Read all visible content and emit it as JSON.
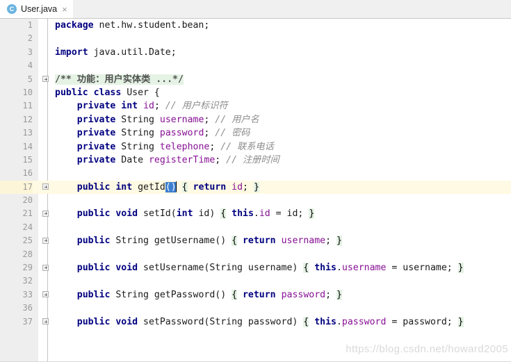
{
  "tab": {
    "icon": "java-class-icon",
    "icon_letter": "C",
    "title": "User.java",
    "close_glyph": "×",
    "accent_color": "#4a86c8"
  },
  "editor": {
    "lines": [
      {
        "num": "1",
        "fold": false,
        "caret": false,
        "tokens": [
          {
            "t": "package",
            "c": "kw"
          },
          {
            "t": " net.hw.student.bean;",
            "c": "txt"
          }
        ]
      },
      {
        "num": "2",
        "fold": false,
        "caret": false,
        "tokens": []
      },
      {
        "num": "3",
        "fold": false,
        "caret": false,
        "tokens": [
          {
            "t": "import",
            "c": "kw"
          },
          {
            "t": " java.util.Date;",
            "c": "txt"
          }
        ]
      },
      {
        "num": "4",
        "fold": false,
        "caret": false,
        "tokens": []
      },
      {
        "num": "5",
        "fold": true,
        "caret": false,
        "tokens": [
          {
            "t": "/** 功能：用户实体类 ...*/",
            "c": "doc-fold"
          }
        ]
      },
      {
        "num": "10",
        "fold": false,
        "caret": false,
        "tokens": [
          {
            "t": "public class",
            "c": "kw"
          },
          {
            "t": " User {",
            "c": "txt"
          }
        ]
      },
      {
        "num": "11",
        "fold": false,
        "caret": false,
        "tokens": [
          {
            "t": "    ",
            "c": "txt"
          },
          {
            "t": "private int",
            "c": "kw"
          },
          {
            "t": " ",
            "c": "txt"
          },
          {
            "t": "id",
            "c": "fld"
          },
          {
            "t": "; ",
            "c": "txt"
          },
          {
            "t": "// 用户标识符",
            "c": "cmt"
          }
        ]
      },
      {
        "num": "12",
        "fold": false,
        "caret": false,
        "tokens": [
          {
            "t": "    ",
            "c": "txt"
          },
          {
            "t": "private",
            "c": "kw"
          },
          {
            "t": " String ",
            "c": "txt"
          },
          {
            "t": "username",
            "c": "fld"
          },
          {
            "t": "; ",
            "c": "txt"
          },
          {
            "t": "// 用户名",
            "c": "cmt"
          }
        ]
      },
      {
        "num": "13",
        "fold": false,
        "caret": false,
        "tokens": [
          {
            "t": "    ",
            "c": "txt"
          },
          {
            "t": "private",
            "c": "kw"
          },
          {
            "t": " String ",
            "c": "txt"
          },
          {
            "t": "password",
            "c": "fld"
          },
          {
            "t": "; ",
            "c": "txt"
          },
          {
            "t": "// 密码",
            "c": "cmt"
          }
        ]
      },
      {
        "num": "14",
        "fold": false,
        "caret": false,
        "tokens": [
          {
            "t": "    ",
            "c": "txt"
          },
          {
            "t": "private",
            "c": "kw"
          },
          {
            "t": " String ",
            "c": "txt"
          },
          {
            "t": "telephone",
            "c": "fld"
          },
          {
            "t": "; ",
            "c": "txt"
          },
          {
            "t": "// 联系电话",
            "c": "cmt"
          }
        ]
      },
      {
        "num": "15",
        "fold": false,
        "caret": false,
        "tokens": [
          {
            "t": "    ",
            "c": "txt"
          },
          {
            "t": "private",
            "c": "kw"
          },
          {
            "t": " Date ",
            "c": "txt"
          },
          {
            "t": "registerTime",
            "c": "fld"
          },
          {
            "t": "; ",
            "c": "txt"
          },
          {
            "t": "// 注册时间",
            "c": "cmt"
          }
        ]
      },
      {
        "num": "16",
        "fold": false,
        "caret": false,
        "tokens": []
      },
      {
        "num": "17",
        "fold": true,
        "caret": true,
        "tokens": [
          {
            "t": "    ",
            "c": "txt"
          },
          {
            "t": "public int",
            "c": "kw"
          },
          {
            "t": " getId",
            "c": "txt"
          },
          {
            "t": "()",
            "c": "sel"
          },
          {
            "t": "│CARET│",
            "c": "caret"
          },
          {
            "t": " ",
            "c": "txt"
          },
          {
            "t": "{",
            "c": "fold-hl"
          },
          {
            "t": " ",
            "c": "txt"
          },
          {
            "t": "return",
            "c": "kw"
          },
          {
            "t": " ",
            "c": "txt"
          },
          {
            "t": "id",
            "c": "fld"
          },
          {
            "t": "; ",
            "c": "txt"
          },
          {
            "t": "}",
            "c": "fold-hl"
          }
        ]
      },
      {
        "num": "20",
        "fold": false,
        "caret": false,
        "tokens": []
      },
      {
        "num": "21",
        "fold": true,
        "caret": false,
        "tokens": [
          {
            "t": "    ",
            "c": "txt"
          },
          {
            "t": "public void",
            "c": "kw"
          },
          {
            "t": " setId(",
            "c": "txt"
          },
          {
            "t": "int",
            "c": "kw"
          },
          {
            "t": " id) ",
            "c": "txt"
          },
          {
            "t": "{",
            "c": "fold-hl"
          },
          {
            "t": " ",
            "c": "txt"
          },
          {
            "t": "this",
            "c": "kw"
          },
          {
            "t": ".",
            "c": "txt"
          },
          {
            "t": "id",
            "c": "fld"
          },
          {
            "t": " = id; ",
            "c": "txt"
          },
          {
            "t": "}",
            "c": "fold-hl"
          }
        ]
      },
      {
        "num": "24",
        "fold": false,
        "caret": false,
        "tokens": []
      },
      {
        "num": "25",
        "fold": true,
        "caret": false,
        "tokens": [
          {
            "t": "    ",
            "c": "txt"
          },
          {
            "t": "public",
            "c": "kw"
          },
          {
            "t": " String getUsername() ",
            "c": "txt"
          },
          {
            "t": "{",
            "c": "fold-hl"
          },
          {
            "t": " ",
            "c": "txt"
          },
          {
            "t": "return",
            "c": "kw"
          },
          {
            "t": " ",
            "c": "txt"
          },
          {
            "t": "username",
            "c": "fld"
          },
          {
            "t": "; ",
            "c": "txt"
          },
          {
            "t": "}",
            "c": "fold-hl"
          }
        ]
      },
      {
        "num": "28",
        "fold": false,
        "caret": false,
        "tokens": []
      },
      {
        "num": "29",
        "fold": true,
        "caret": false,
        "tokens": [
          {
            "t": "    ",
            "c": "txt"
          },
          {
            "t": "public void",
            "c": "kw"
          },
          {
            "t": " setUsername(String username) ",
            "c": "txt"
          },
          {
            "t": "{",
            "c": "fold-hl"
          },
          {
            "t": " ",
            "c": "txt"
          },
          {
            "t": "this",
            "c": "kw"
          },
          {
            "t": ".",
            "c": "txt"
          },
          {
            "t": "username",
            "c": "fld"
          },
          {
            "t": " = username; ",
            "c": "txt"
          },
          {
            "t": "}",
            "c": "fold-hl"
          }
        ]
      },
      {
        "num": "32",
        "fold": false,
        "caret": false,
        "tokens": []
      },
      {
        "num": "33",
        "fold": true,
        "caret": false,
        "tokens": [
          {
            "t": "    ",
            "c": "txt"
          },
          {
            "t": "public",
            "c": "kw"
          },
          {
            "t": " String getPassword() ",
            "c": "txt"
          },
          {
            "t": "{",
            "c": "fold-hl"
          },
          {
            "t": " ",
            "c": "txt"
          },
          {
            "t": "return",
            "c": "kw"
          },
          {
            "t": " ",
            "c": "txt"
          },
          {
            "t": "password",
            "c": "fld"
          },
          {
            "t": "; ",
            "c": "txt"
          },
          {
            "t": "}",
            "c": "fold-hl"
          }
        ]
      },
      {
        "num": "36",
        "fold": false,
        "caret": false,
        "tokens": []
      },
      {
        "num": "37",
        "fold": true,
        "caret": false,
        "tokens": [
          {
            "t": "    ",
            "c": "txt"
          },
          {
            "t": "public void",
            "c": "kw"
          },
          {
            "t": " setPassword(String password) ",
            "c": "txt"
          },
          {
            "t": "{",
            "c": "fold-hl"
          },
          {
            "t": " ",
            "c": "txt"
          },
          {
            "t": "this",
            "c": "kw"
          },
          {
            "t": ".",
            "c": "txt"
          },
          {
            "t": "password",
            "c": "fld"
          },
          {
            "t": " = password; ",
            "c": "txt"
          },
          {
            "t": "}",
            "c": "fold-hl"
          }
        ]
      }
    ]
  },
  "watermark": {
    "text": "https://blog.csdn.net/howard2005"
  }
}
